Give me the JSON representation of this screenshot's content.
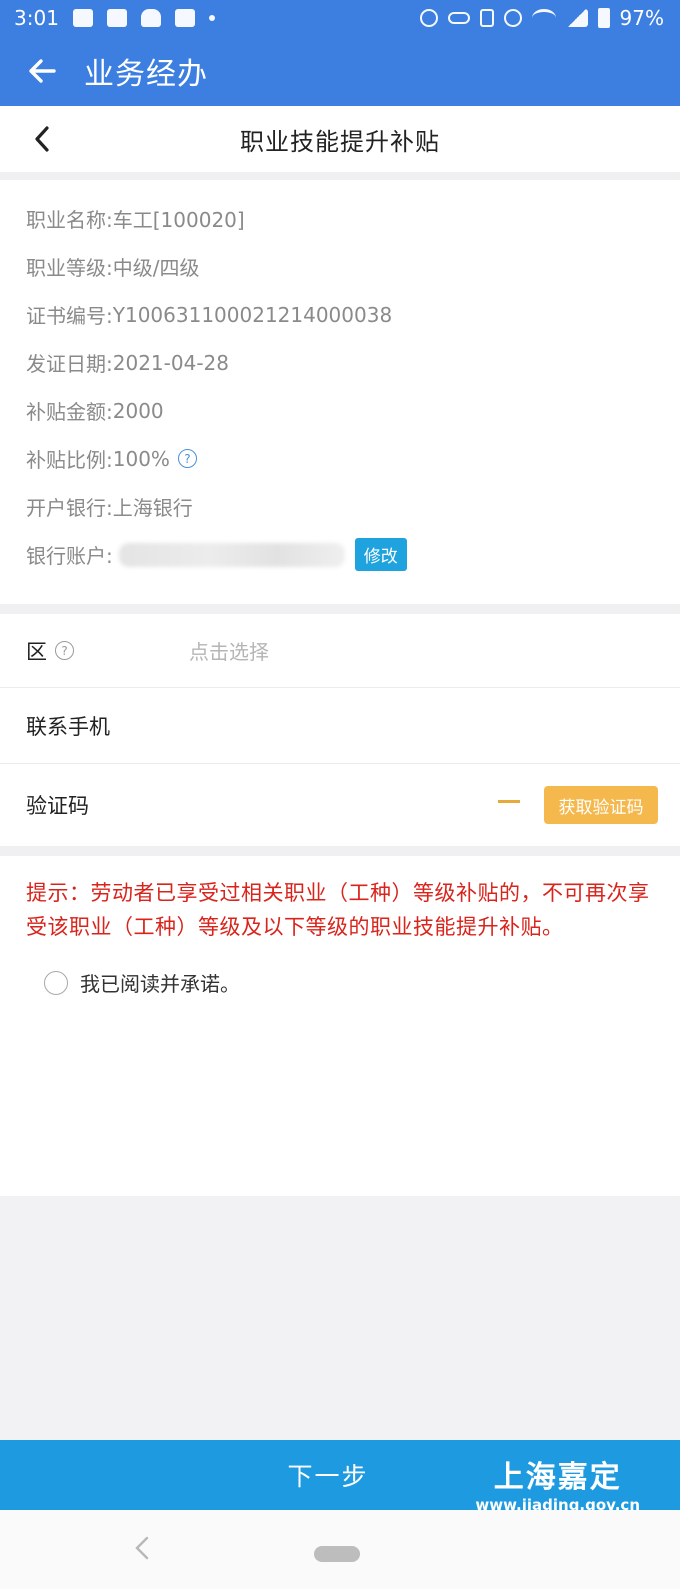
{
  "status_bar": {
    "time": "3:01",
    "battery": "97%",
    "icons_left": [
      "image-icon",
      "note-icon",
      "bell-icon",
      "square-icon",
      "dot-icon"
    ],
    "icons_right": [
      "alarm-icon",
      "key-icon",
      "vibrate-icon",
      "do-not-disturb-icon",
      "wifi-icon",
      "signal-icon",
      "battery-icon"
    ]
  },
  "app_bar": {
    "title": "业务经办"
  },
  "sub_header": {
    "title": "职业技能提升补贴"
  },
  "info": {
    "occupation_name": {
      "label": "职业名称: ",
      "value": "车工[100020]"
    },
    "occupation_level": {
      "label": "职业等级: ",
      "value": "中级/四级"
    },
    "certificate_no": {
      "label": "证书编号: ",
      "value": "Y100631100021214000038"
    },
    "issue_date": {
      "label": "发证日期: ",
      "value": "2021-04-28"
    },
    "subsidy_amount": {
      "label": "补贴金额: ",
      "value": "2000"
    },
    "subsidy_ratio": {
      "label": "补贴比例: ",
      "value": "100%",
      "help": "?"
    },
    "bank": {
      "label": "开户银行: ",
      "value": "上海银行"
    },
    "bank_account": {
      "label": "银行账户: ",
      "edit_label": "修改"
    }
  },
  "form": {
    "district": {
      "label": "区",
      "help": "?",
      "placeholder": "点击选择"
    },
    "phone": {
      "label": "联系手机"
    },
    "verify_code": {
      "label": "验证码",
      "button": "获取验证码"
    }
  },
  "tip": "提示：劳动者已享受过相关职业（工种）等级补贴的，不可再次享受该职业（工种）等级及以下等级的职业技能提升补贴。",
  "agreement": {
    "label": "我已阅读并承诺。"
  },
  "next_button": {
    "label": "下一步"
  },
  "watermark": {
    "title": "上海嘉定",
    "url": "www.jiading.gov.cn"
  },
  "colors": {
    "primary_blue": "#3d7fe0",
    "button_blue": "#1e9be0",
    "tip_red": "#d9241c",
    "code_orange": "#f5b84c"
  }
}
